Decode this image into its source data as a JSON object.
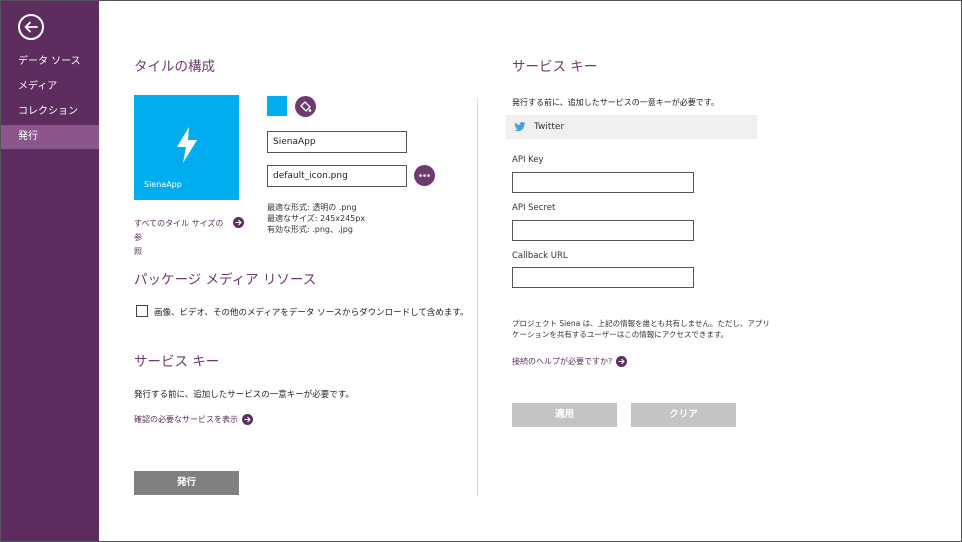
{
  "sidebar": {
    "items": [
      {
        "label": "データ ソース"
      },
      {
        "label": "メディア"
      },
      {
        "label": "コレクション"
      },
      {
        "label": "発行"
      }
    ]
  },
  "tile_config": {
    "heading": "タイルの構成",
    "tile_label": "SienaApp",
    "tile_color": "#00adef",
    "app_name_value": "SienaApp",
    "icon_file_value": "default_icon.png",
    "format_lines": [
      "最適な形式: 透明の .png",
      "最適なサイズ: 245x245px",
      "有効な形式: .png、.jpg"
    ],
    "see_all_sizes_link": [
      "すべてのタイル サイズの参",
      "照"
    ]
  },
  "package_media": {
    "heading": "パッケージ メディア リソース",
    "checkbox_label": "画像、ビデオ、その他のメディアをデータ ソースからダウンロードして含めます。"
  },
  "service_keys_left": {
    "heading": "サービス キー",
    "description": "発行する前に、追加したサービスの一意キーが必要です。",
    "link": "確認の必要なサービスを表示"
  },
  "publish_button": "発行",
  "service_keys_right": {
    "heading": "サービス キー",
    "description": "発行する前に、追加したサービスの一意キーが必要です。",
    "service_name": "Twitter",
    "api_key_label": "API Key",
    "api_secret_label": "API Secret",
    "callback_label": "Callback URL",
    "privacy_lines": [
      "プロジェクト Siena は、上記の情報を誰とも共有しません。ただし、アプリ",
      "ケーションを共有するユーザーはこの情報にアクセスできます。"
    ],
    "help_link": "接続のヘルプが必要ですか?",
    "apply_button": "適用",
    "clear_button": "クリア"
  },
  "colors": {
    "sidebar": "#5c2d5e",
    "sidebar_active": "#8b568c",
    "accent": "#6e3a70",
    "tile": "#00adef"
  }
}
